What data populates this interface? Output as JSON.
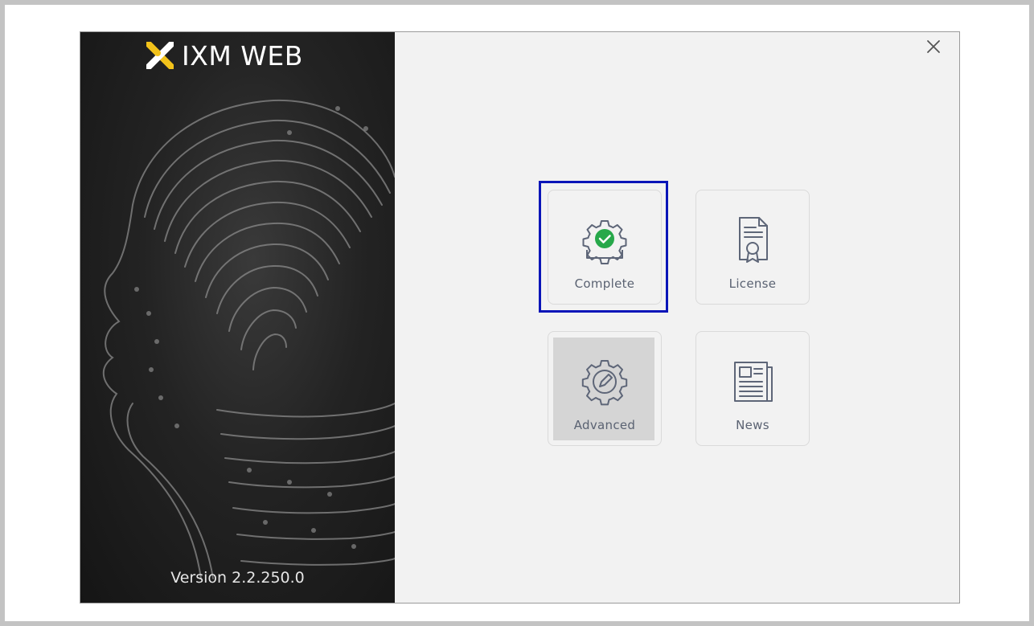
{
  "app": {
    "brand_title": "IXM WEB",
    "version": "Version 2.2.250.0"
  },
  "window": {
    "close_icon": "close-icon"
  },
  "tiles": [
    {
      "label": "Complete",
      "icon": "gear-check-icon",
      "selected": true
    },
    {
      "label": "License",
      "icon": "certificate-icon",
      "selected": false
    },
    {
      "label": "Advanced",
      "icon": "gear-edit-icon",
      "selected": false,
      "state": "pressed"
    },
    {
      "label": "News",
      "icon": "newspaper-icon",
      "selected": false
    }
  ],
  "colors": {
    "selection_border": "#0a15b8",
    "check_green": "#27a84a",
    "icon_stroke": "#5e6678",
    "logo_gold": "#f2c21a"
  }
}
